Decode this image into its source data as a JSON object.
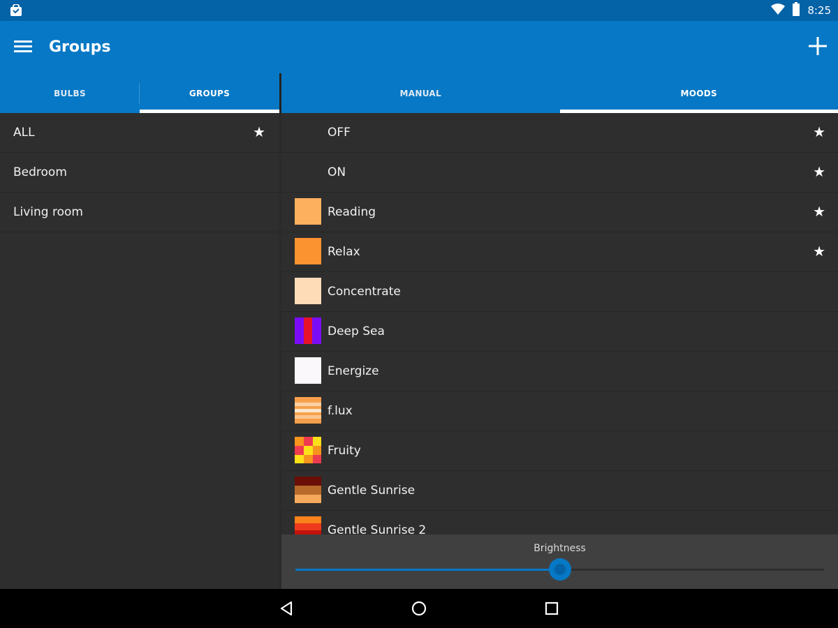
{
  "status_bar": {
    "time": "8:25",
    "icons": [
      "shopping-bag-icon",
      "wifi-icon",
      "battery-icon"
    ]
  },
  "app_bar": {
    "title": "Groups",
    "menu_icon": "hamburger-menu-icon",
    "add_icon": "plus-icon"
  },
  "left_tabs": [
    {
      "label": "BULBS",
      "active": false
    },
    {
      "label": "GROUPS",
      "active": true
    }
  ],
  "right_tabs": [
    {
      "label": "MANUAL",
      "active": false
    },
    {
      "label": "MOODS",
      "active": true
    }
  ],
  "groups": [
    {
      "label": "ALL",
      "starred": true
    },
    {
      "label": "Bedroom",
      "starred": false
    },
    {
      "label": "Living room",
      "starred": false
    }
  ],
  "moods": [
    {
      "label": "OFF",
      "starred": true,
      "swatch": null
    },
    {
      "label": "ON",
      "starred": true,
      "swatch": null
    },
    {
      "label": "Reading",
      "starred": true,
      "swatch": "reading"
    },
    {
      "label": "Relax",
      "starred": true,
      "swatch": "relax"
    },
    {
      "label": "Concentrate",
      "starred": false,
      "swatch": "concentrate"
    },
    {
      "label": "Deep Sea",
      "starred": false,
      "swatch": "deep-sea"
    },
    {
      "label": "Energize",
      "starred": false,
      "swatch": "energize"
    },
    {
      "label": "f.lux",
      "starred": false,
      "swatch": "flux"
    },
    {
      "label": "Fruity",
      "starred": false,
      "swatch": "fruity"
    },
    {
      "label": "Gentle Sunrise",
      "starred": false,
      "swatch": "gentle-sunrise"
    },
    {
      "label": "Gentle Sunrise 2",
      "starred": false,
      "swatch": "gentle-sunrise-2"
    }
  ],
  "star_glyph": "★",
  "brightness": {
    "label": "Brightness",
    "value": 0.5
  },
  "nav_bar": {
    "icons": [
      "back-icon",
      "home-icon",
      "recents-icon"
    ]
  },
  "colors": {
    "primary": "#0678c5",
    "status_bar": "#0462a6",
    "background": "#2e2e2e",
    "panel": "#404040"
  }
}
